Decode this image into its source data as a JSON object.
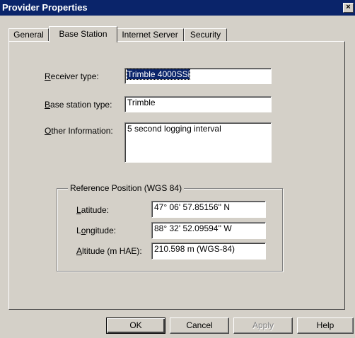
{
  "window": {
    "title": "Provider Properties",
    "close_glyph": "×"
  },
  "tabs": [
    "General",
    "Base Station",
    "Internet Server",
    "Security"
  ],
  "active_tab": "Base Station",
  "form": {
    "receiver_type": {
      "label_first": "R",
      "label_rest": "eceiver type:",
      "value": "Trimble 4000SSi"
    },
    "base_station_type": {
      "label_first": "B",
      "label_rest": "ase station type:",
      "value": "Trimble"
    },
    "other_information": {
      "label_first": "O",
      "label_rest": "ther Information:",
      "value": "5 second logging interval"
    }
  },
  "reference_position": {
    "title": "Reference Position (WGS 84)",
    "latitude": {
      "label_first": "L",
      "label_rest": "atitude:",
      "value": "47° 06' 57.85156'' N"
    },
    "longitude": {
      "label_first": "o",
      "label_pre": "L",
      "label_rest": "ngitude:",
      "value": "88° 32' 52.09594'' W"
    },
    "altitude": {
      "label_first": "A",
      "label_rest": "ltitude (m HAE):",
      "value": "210.598 m (WGS-84)"
    }
  },
  "buttons": {
    "ok": "OK",
    "cancel": "Cancel",
    "apply": "Apply",
    "help": "Help"
  },
  "colors": {
    "title_bar": "#0a246a",
    "face": "#d4d0c8"
  }
}
